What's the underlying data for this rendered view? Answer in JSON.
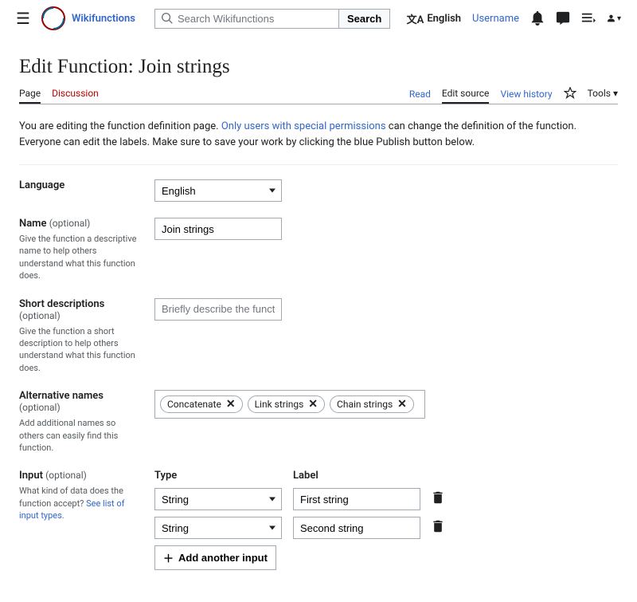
{
  "header": {
    "site_name": "Wikifunctions",
    "search_placeholder": "Search Wikifunctions",
    "search_button": "Search",
    "language": "English",
    "username": "Username"
  },
  "page_title": "Edit Function: Join strings",
  "tabs": {
    "page": "Page",
    "discussion": "Discussion",
    "read": "Read",
    "edit_source": "Edit source",
    "view_history": "View history",
    "tools": "Tools"
  },
  "notice": {
    "prefix": "You are editing the function definition page. ",
    "link": "Only users with special permissions",
    "suffix": " can change the definition of the function. Everyone can edit the labels. Make sure to save your work by clicking the blue Publish button below."
  },
  "form": {
    "language": {
      "label": "Language",
      "value": "English"
    },
    "name": {
      "label": "Name",
      "optional": "(optional)",
      "hint": "Give the function a descriptive name to help others understand what this function does.",
      "value": "Join strings"
    },
    "short_desc": {
      "label": "Short descriptions",
      "optional": "(optional)",
      "hint": "Give the function a short description to help others understand what this function does.",
      "placeholder": "Briefly describe the function."
    },
    "alt_names": {
      "label": "Alternative names",
      "optional": "(optional)",
      "hint": "Add additional names so others can easily find this function.",
      "chips": [
        "Concatenate",
        "Link strings",
        "Chain strings"
      ]
    },
    "input": {
      "label": "Input",
      "optional": "(optional)",
      "hint_prefix": "What kind of data does the function accept? ",
      "hint_link": "See list of input types.",
      "type_col": "Type",
      "label_col": "Label",
      "rows": [
        {
          "type": "String",
          "label": "First string"
        },
        {
          "type": "String",
          "label": "Second string"
        }
      ],
      "add_button": "Add another input"
    }
  }
}
